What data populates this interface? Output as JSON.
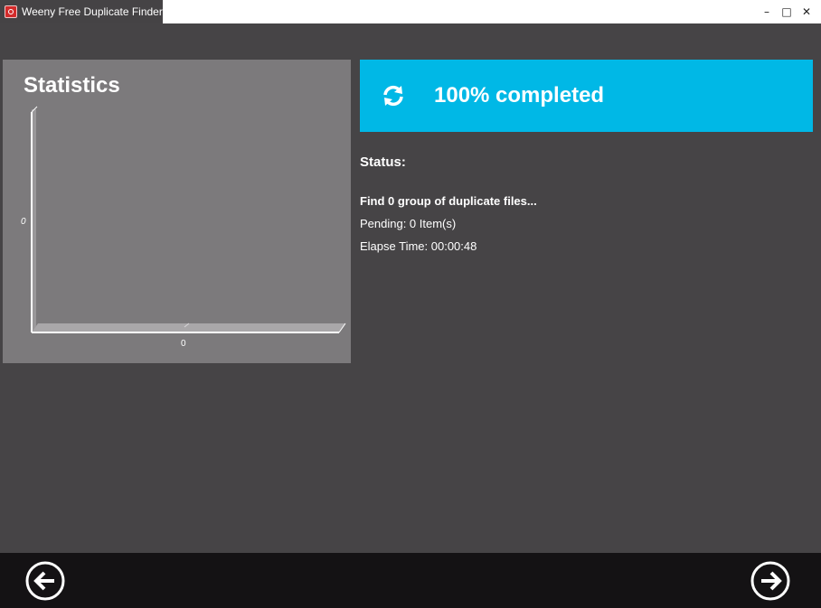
{
  "window": {
    "title": "Weeny Free Duplicate Finder",
    "controls": {
      "minimize": "–",
      "maximize": "□",
      "close": "✕"
    }
  },
  "statistics": {
    "title": "Statistics",
    "chart_data": {
      "type": "bar",
      "categories": [
        "0"
      ],
      "values": [
        0
      ],
      "yticks": [
        "0"
      ],
      "grid": false
    }
  },
  "progress": {
    "icon": "refresh-icon",
    "text": "100% completed",
    "value": 1.0,
    "color": "#00b8e6"
  },
  "status": {
    "heading": "Status:",
    "found": "Find 0 group of duplicate files...",
    "pending": "Pending:  0 Item(s)",
    "elapsed": "Elapse Time: 00:00:48"
  },
  "nav": {
    "back_icon": "arrow-left-circle-icon",
    "next_icon": "arrow-right-circle-icon"
  }
}
